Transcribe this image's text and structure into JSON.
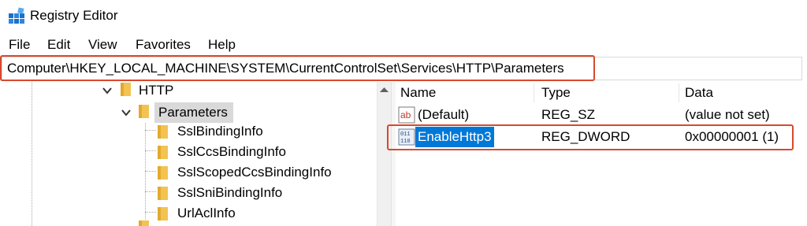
{
  "window": {
    "title": "Registry Editor"
  },
  "menu": [
    "File",
    "Edit",
    "View",
    "Favorites",
    "Help"
  ],
  "address": {
    "path": "Computer\\HKEY_LOCAL_MACHINE\\SYSTEM\\CurrentControlSet\\Services\\HTTP\\Parameters"
  },
  "tree": {
    "items": [
      {
        "label": "HTTP",
        "expanded": true
      },
      {
        "label": "Parameters",
        "expanded": true,
        "selected": true
      },
      {
        "label": "SslBindingInfo"
      },
      {
        "label": "SslCcsBindingInfo"
      },
      {
        "label": "SslScopedCcsBindingInfo"
      },
      {
        "label": "SslSniBindingInfo"
      },
      {
        "label": "UrlAclInfo"
      }
    ]
  },
  "list": {
    "columns": [
      "Name",
      "Type",
      "Data"
    ],
    "rows": [
      {
        "icon": "string-value-icon",
        "icon_text": "ab",
        "name": "(Default)",
        "type": "REG_SZ",
        "data": "(value not set)"
      },
      {
        "icon": "dword-value-icon",
        "icon_text": "011 110",
        "name": "EnableHttp3",
        "type": "REG_DWORD",
        "data": "0x00000001 (1)",
        "selected": true
      }
    ]
  },
  "colors": {
    "highlight_border": "#d8492c",
    "selection": "#0078d7",
    "folder": "#f3c351"
  }
}
